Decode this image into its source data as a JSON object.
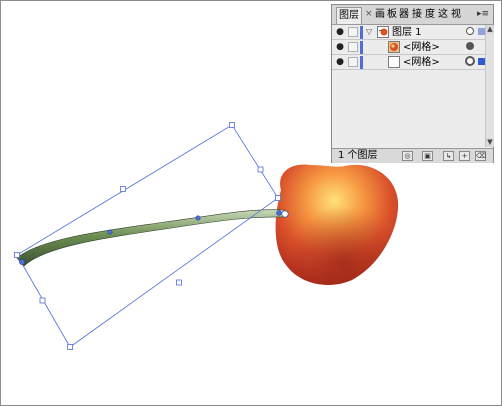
{
  "panel": {
    "tabs": [
      {
        "label": "图层",
        "active": true
      },
      {
        "label": "画"
      },
      {
        "label": "板"
      },
      {
        "label": "器"
      },
      {
        "label": "接"
      },
      {
        "label": "度"
      },
      {
        "label": "这"
      },
      {
        "label": "视"
      }
    ],
    "close_glyph": "×",
    "menu_glyph": "▸≡",
    "layers": [
      {
        "label": "图层 1",
        "kind": "layer",
        "expanded": true,
        "visible": true
      },
      {
        "label": "<网格>",
        "kind": "object",
        "thumbnail": "cherry-body"
      },
      {
        "label": "<网格>",
        "kind": "object",
        "thumbnail": "blank",
        "selected": true
      }
    ],
    "layer_count": "1 个图层",
    "accent_color": "#4f6fd8"
  },
  "icons": {
    "eye": "eye-icon",
    "expand": "triangle-down-icon",
    "locate": "locate-object-icon",
    "make_mask": "clipping-mask-icon",
    "new_sublayer": "new-sublayer-icon",
    "new_layer": "new-layer-icon",
    "delete": "trash-icon"
  }
}
